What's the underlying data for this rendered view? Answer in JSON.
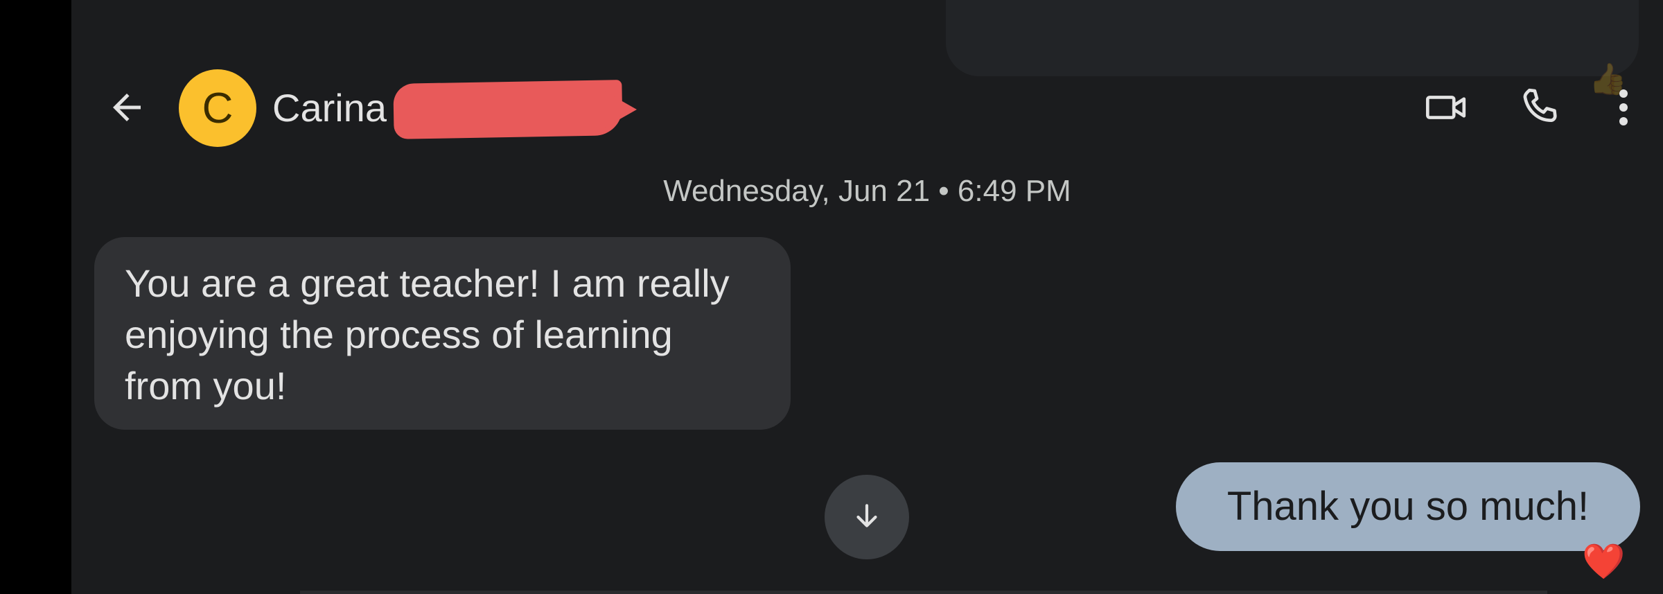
{
  "header": {
    "contact_name": "Carina",
    "avatar_letter": "C"
  },
  "conversation": {
    "timestamp": "Wednesday, Jun 21 • 6:49 PM",
    "messages": [
      {
        "direction": "incoming",
        "text": "You are a great teacher!  I am really enjoying the process of learning from you!"
      },
      {
        "direction": "outgoing",
        "text": "Thank you so much!",
        "reaction": "❤️"
      }
    ]
  },
  "icons": {
    "back": "back-arrow-icon",
    "video": "video-call-icon",
    "call": "phone-call-icon",
    "more": "more-vert-icon",
    "scroll": "arrow-down-icon"
  },
  "colors": {
    "background": "#1b1c1e",
    "incoming_bubble": "#303134",
    "outgoing_bubble": "#9eb0c3",
    "avatar": "#fbc02d",
    "redaction": "#e85a5a"
  }
}
